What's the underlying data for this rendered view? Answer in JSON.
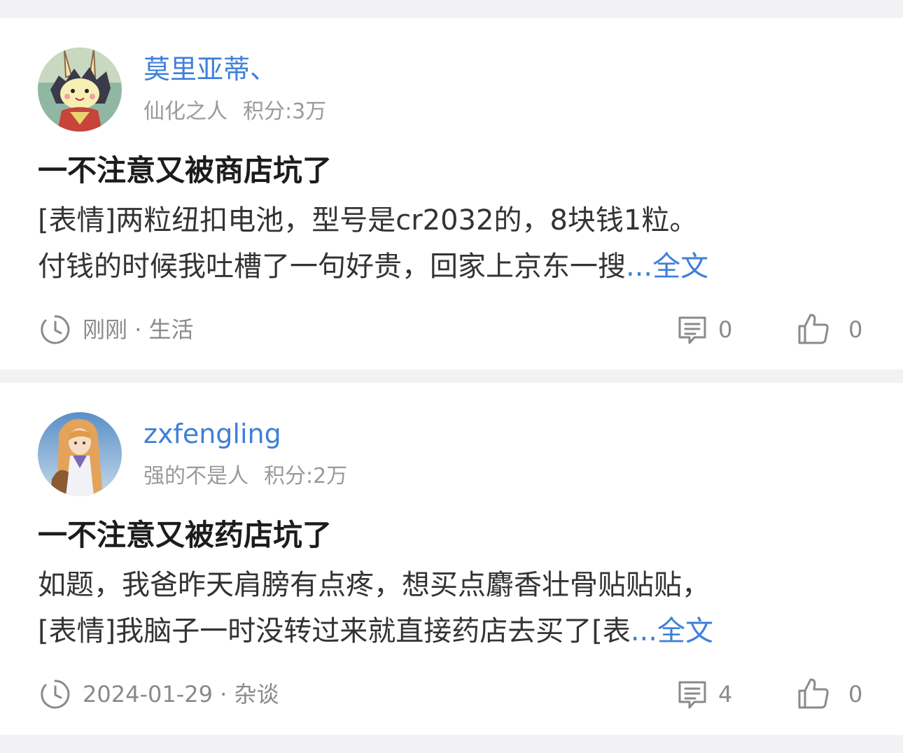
{
  "posts": [
    {
      "username": "莫里亚蒂、",
      "user_title": "仙化之人",
      "score": "积分:3万",
      "title": "一不注意又被商店坑了",
      "excerpt_line1": "[表情]两粒纽扣电池，型号是cr2032的，8块钱1粒。",
      "excerpt_line2": "付钱的时候我吐槽了一句好贵，回家上京东一搜",
      "ellipsis": "...",
      "full_text_label": "全文",
      "time": "刚刚",
      "separator": " · ",
      "category": "生活",
      "comments": "0",
      "likes": "0",
      "avatar_icon": "cartoon-rabbit-avatar"
    },
    {
      "username": "zxfengling",
      "user_title": "强的不是人",
      "score": "积分:2万",
      "title": "一不注意又被药店坑了",
      "excerpt_line1": "如题，我爸昨天肩膀有点疼，想买点麝香壮骨贴贴贴，",
      "excerpt_line2": "[表情]我脑子一时没转过来就直接药店去买了[表",
      "ellipsis": "...",
      "full_text_label": "全文",
      "time": "2024-01-29",
      "separator": " · ",
      "category": "杂谈",
      "comments": "4",
      "likes": "0",
      "avatar_icon": "anime-girl-avatar"
    }
  ],
  "icons": {
    "time": "clock-icon",
    "comments": "comment-icon",
    "likes": "thumbs-up-icon"
  },
  "colors": {
    "background": "#f2f2f4",
    "card": "#ffffff",
    "link_blue": "#3f7fd8",
    "title_text": "#1c1c1c",
    "body_text": "#333333",
    "meta_gray": "#9a9a9a"
  }
}
